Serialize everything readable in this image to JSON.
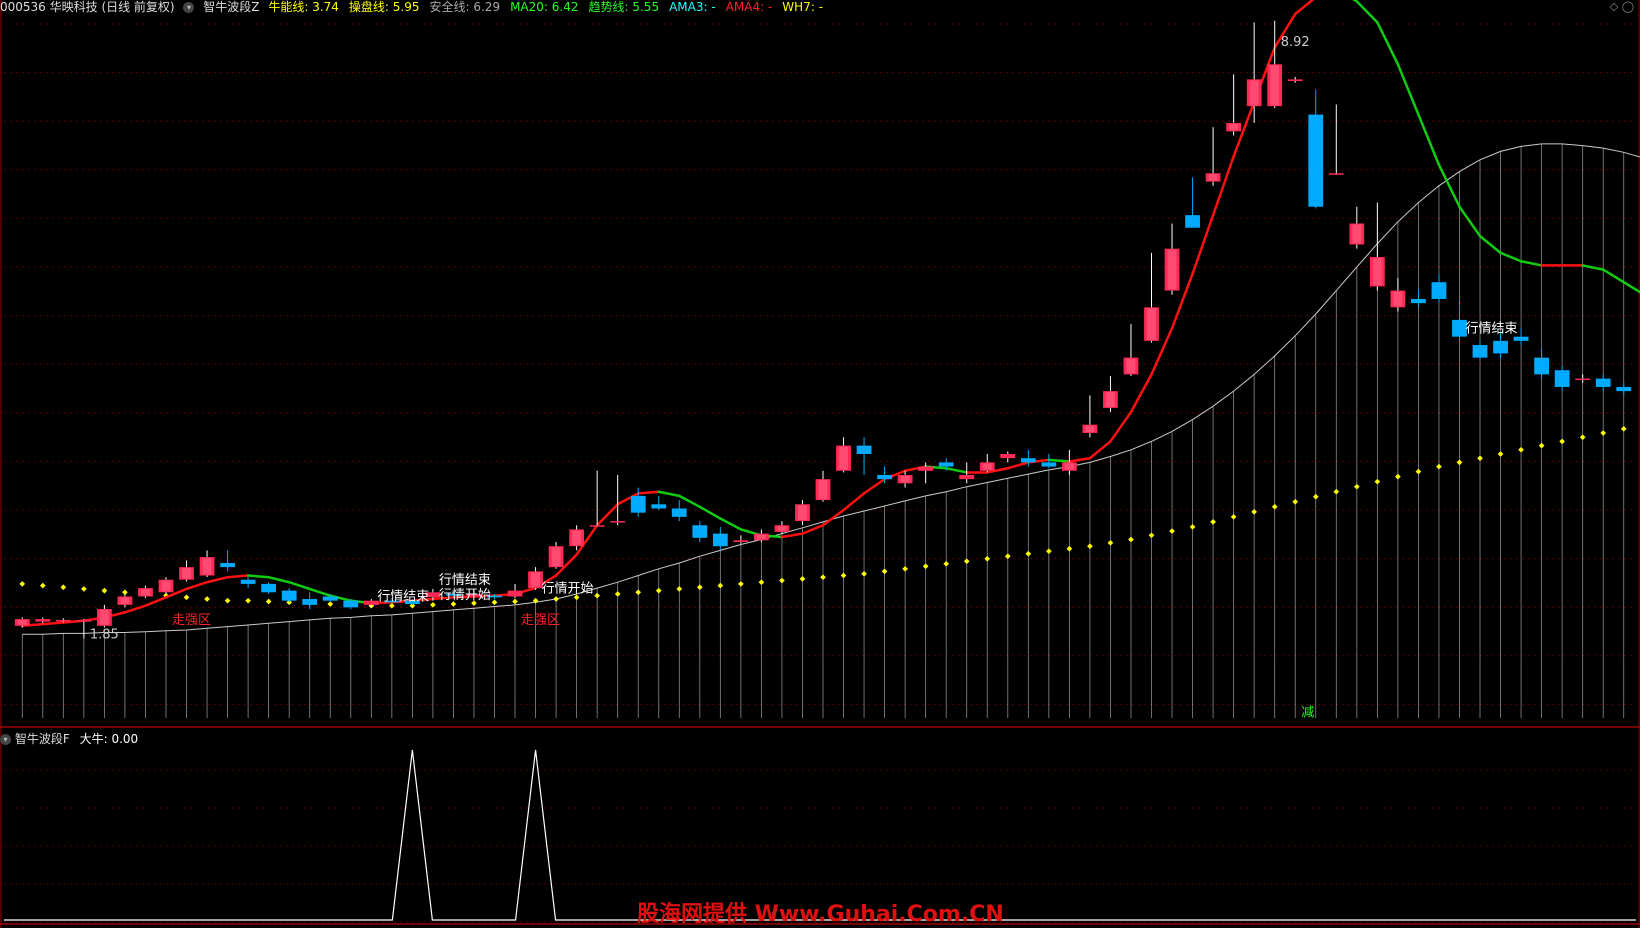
{
  "header": {
    "code_name": "000536 华映科技 (日线 前复权)",
    "indicator": "智牛波段Z",
    "items": [
      {
        "label": "牛能线:",
        "value": "3.74",
        "color": "#ffff00"
      },
      {
        "label": "操盘线:",
        "value": "5.95",
        "color": "#ffff00"
      },
      {
        "label": "安全线:",
        "value": "6.29",
        "color": "#aaaaaa"
      },
      {
        "label": "MA20:",
        "value": "6.42",
        "color": "#22ff22"
      },
      {
        "label": "趋势线:",
        "value": "5.55",
        "color": "#22ff22"
      },
      {
        "label": "AMA3:",
        "value": "-",
        "color": "#22ffff"
      },
      {
        "label": "AMA4:",
        "value": "-",
        "color": "#ff2222"
      },
      {
        "label": "WH7:",
        "value": "-",
        "color": "#ffff00"
      }
    ]
  },
  "sub_header": {
    "indicator": "智牛波段F",
    "label": "大牛:",
    "value": "0.00"
  },
  "watermark": "股海网提供 Www.Guhai.Com.CN",
  "colors": {
    "up": "#ff2a55",
    "down": "#00aaff",
    "trend_up": "#ff1111",
    "trend_down": "#11cc11",
    "dots": "#ffff00",
    "grid": "#5a0000"
  },
  "chart_data": [
    {
      "type": "candlestick",
      "ylim": [
        0.9,
        9.3
      ],
      "annotations": [
        {
          "text": "8.92",
          "index": 61,
          "price": 8.92,
          "color": "#cccccc"
        },
        {
          "text": "1.85",
          "index": 3,
          "price": 1.85,
          "color": "#cccccc"
        },
        {
          "text": "走强区",
          "index": 7,
          "price": 2.02,
          "color": "#ff2222"
        },
        {
          "text": "走强区",
          "index": 24,
          "price": 2.02,
          "color": "#ff2222"
        },
        {
          "text": "行情结束",
          "index": 17,
          "price": 2.3,
          "color": "#ffffff"
        },
        {
          "text": "行情结束",
          "index": 20,
          "price": 2.5,
          "color": "#ffffff"
        },
        {
          "text": "行情开始",
          "index": 20,
          "price": 2.32,
          "color": "#ffffff"
        },
        {
          "text": "行情开始",
          "index": 25,
          "price": 2.4,
          "color": "#ffffff"
        },
        {
          "text": "行情结束",
          "index": 70,
          "price": 5.5,
          "color": "#ffffff"
        },
        {
          "text": "减",
          "index": 62,
          "price": 0.92,
          "color": "#22ff22"
        }
      ],
      "candles": [
        [
          2.0,
          2.08,
          2.1,
          1.98
        ],
        [
          2.05,
          2.08,
          2.1,
          2.03
        ],
        [
          2.06,
          2.07,
          2.09,
          2.04
        ],
        [
          2.05,
          2.07,
          2.08,
          1.85
        ],
        [
          2.0,
          2.2,
          2.25,
          1.98
        ],
        [
          2.25,
          2.35,
          2.38,
          2.22
        ],
        [
          2.35,
          2.45,
          2.48,
          2.33
        ],
        [
          2.4,
          2.55,
          2.58,
          2.38
        ],
        [
          2.55,
          2.7,
          2.78,
          2.53
        ],
        [
          2.6,
          2.82,
          2.9,
          2.58
        ],
        [
          2.75,
          2.7,
          2.9,
          2.65
        ],
        [
          2.55,
          2.5,
          2.58,
          2.45
        ],
        [
          2.5,
          2.4,
          2.52,
          2.38
        ],
        [
          2.42,
          2.3,
          2.45,
          2.28
        ],
        [
          2.32,
          2.25,
          2.4,
          2.2
        ],
        [
          2.35,
          2.3,
          2.38,
          2.28
        ],
        [
          2.3,
          2.22,
          2.32,
          2.2
        ],
        [
          2.25,
          2.3,
          2.32,
          2.22
        ],
        [
          2.3,
          2.28,
          2.33,
          2.27
        ],
        [
          2.3,
          2.26,
          2.32,
          2.25
        ],
        [
          2.34,
          2.4,
          2.44,
          2.3
        ],
        [
          2.38,
          2.36,
          2.4,
          2.34
        ],
        [
          2.35,
          2.38,
          2.42,
          2.33
        ],
        [
          2.36,
          2.34,
          2.38,
          2.32
        ],
        [
          2.35,
          2.42,
          2.5,
          2.33
        ],
        [
          2.45,
          2.65,
          2.7,
          2.43
        ],
        [
          2.7,
          2.95,
          3.0,
          2.68
        ],
        [
          2.95,
          3.15,
          3.2,
          2.9
        ],
        [
          3.2,
          3.2,
          3.85,
          3.18
        ],
        [
          3.25,
          3.25,
          3.8,
          3.2
        ],
        [
          3.55,
          3.35,
          3.65,
          3.3
        ],
        [
          3.45,
          3.4,
          3.55,
          3.38
        ],
        [
          3.4,
          3.3,
          3.5,
          3.25
        ],
        [
          3.2,
          3.05,
          3.25,
          3.0
        ],
        [
          3.1,
          2.95,
          3.18,
          2.9
        ],
        [
          3.0,
          3.02,
          3.08,
          2.98
        ],
        [
          3.02,
          3.1,
          3.15,
          3.0
        ],
        [
          3.12,
          3.2,
          3.25,
          3.1
        ],
        [
          3.25,
          3.45,
          3.5,
          3.2
        ],
        [
          3.5,
          3.75,
          3.85,
          3.48
        ],
        [
          3.85,
          4.15,
          4.25,
          3.83
        ],
        [
          4.15,
          4.05,
          4.25,
          3.8
        ],
        [
          3.8,
          3.75,
          3.9,
          3.7
        ],
        [
          3.7,
          3.8,
          3.85,
          3.65
        ],
        [
          3.85,
          3.9,
          3.95,
          3.7
        ],
        [
          3.95,
          3.9,
          4.0,
          3.85
        ],
        [
          3.75,
          3.8,
          3.95,
          3.7
        ],
        [
          3.85,
          3.95,
          4.05,
          3.83
        ],
        [
          4.0,
          4.05,
          4.08,
          3.95
        ],
        [
          4.0,
          3.95,
          4.1,
          3.9
        ],
        [
          3.95,
          3.9,
          4.05,
          3.88
        ],
        [
          3.85,
          3.95,
          4.1,
          3.8
        ],
        [
          4.3,
          4.4,
          4.75,
          4.25
        ],
        [
          4.6,
          4.8,
          4.98,
          4.55
        ],
        [
          5.0,
          5.2,
          5.6,
          4.98
        ],
        [
          5.4,
          5.8,
          6.45,
          5.38
        ],
        [
          6.0,
          6.5,
          6.8,
          5.95
        ],
        [
          6.9,
          6.75,
          7.35,
          6.85
        ],
        [
          7.3,
          7.4,
          7.95,
          7.25
        ],
        [
          7.9,
          8.0,
          8.58,
          7.85
        ],
        [
          8.2,
          8.52,
          9.2,
          8.0
        ],
        [
          8.2,
          8.7,
          9.22,
          8.18
        ],
        [
          8.5,
          8.52,
          8.55,
          8.48
        ],
        [
          8.1,
          7.0,
          8.4,
          6.98
        ],
        [
          7.4,
          7.4,
          8.22,
          7.38
        ],
        [
          6.55,
          6.8,
          7.0,
          6.5
        ],
        [
          6.05,
          6.4,
          7.05,
          6.0
        ],
        [
          5.8,
          6.0,
          6.15,
          5.75
        ],
        [
          5.9,
          5.85,
          6.0,
          5.8
        ],
        [
          6.1,
          5.9,
          6.2,
          5.85
        ],
        [
          5.65,
          5.45,
          5.9,
          5.4
        ],
        [
          5.35,
          5.2,
          5.4,
          5.18
        ],
        [
          5.4,
          5.25,
          5.5,
          5.2
        ],
        [
          5.45,
          5.4,
          5.55,
          5.35
        ],
        [
          5.2,
          5.0,
          5.3,
          4.95
        ],
        [
          5.05,
          4.85,
          5.1,
          4.8
        ],
        [
          4.95,
          4.95,
          5.0,
          4.9
        ],
        [
          4.95,
          4.85,
          5.0,
          4.8
        ],
        [
          4.85,
          4.8,
          4.9,
          4.75
        ]
      ],
      "trend_line": [
        2.0,
        2.02,
        2.04,
        2.06,
        2.1,
        2.16,
        2.24,
        2.34,
        2.44,
        2.52,
        2.58,
        2.6,
        2.58,
        2.52,
        2.44,
        2.36,
        2.3,
        2.27,
        2.28,
        2.3,
        2.32,
        2.34,
        2.35,
        2.36,
        2.38,
        2.45,
        2.6,
        2.85,
        3.2,
        3.45,
        3.58,
        3.6,
        3.55,
        3.42,
        3.28,
        3.15,
        3.08,
        3.06,
        3.1,
        3.2,
        3.38,
        3.58,
        3.75,
        3.85,
        3.9,
        3.88,
        3.83,
        3.83,
        3.88,
        3.95,
        3.98,
        3.96,
        4.0,
        4.2,
        4.55,
        5.0,
        5.55,
        6.2,
        6.9,
        7.6,
        8.25,
        8.9,
        9.3,
        9.5,
        9.6,
        9.45,
        9.2,
        8.7,
        8.1,
        7.5,
        7.0,
        6.65,
        6.45,
        6.35,
        6.3,
        6.3,
        6.3,
        6.25,
        6.1,
        5.95
      ],
      "safety_line": [
        1.9,
        1.9,
        1.91,
        1.91,
        1.92,
        1.92,
        1.93,
        1.94,
        1.95,
        1.97,
        1.99,
        2.01,
        2.03,
        2.05,
        2.07,
        2.09,
        2.1,
        2.12,
        2.13,
        2.15,
        2.17,
        2.19,
        2.21,
        2.23,
        2.25,
        2.28,
        2.32,
        2.38,
        2.45,
        2.52,
        2.6,
        2.68,
        2.75,
        2.83,
        2.9,
        2.97,
        3.03,
        3.1,
        3.17,
        3.24,
        3.31,
        3.37,
        3.43,
        3.49,
        3.55,
        3.6,
        3.66,
        3.71,
        3.76,
        3.81,
        3.86,
        3.9,
        3.95,
        4.02,
        4.1,
        4.2,
        4.32,
        4.46,
        4.62,
        4.8,
        5.0,
        5.22,
        5.46,
        5.72,
        6.0,
        6.28,
        6.56,
        6.82,
        7.05,
        7.25,
        7.42,
        7.56,
        7.66,
        7.72,
        7.75,
        7.75,
        7.73,
        7.7,
        7.65,
        7.58
      ],
      "yellow_dots": [
        2.5,
        2.48,
        2.46,
        2.44,
        2.42,
        2.4,
        2.38,
        2.36,
        2.34,
        2.32,
        2.3,
        2.3,
        2.29,
        2.28,
        2.27,
        2.26,
        2.25,
        2.24,
        2.24,
        2.24,
        2.25,
        2.26,
        2.27,
        2.28,
        2.29,
        2.3,
        2.32,
        2.34,
        2.36,
        2.38,
        2.4,
        2.42,
        2.44,
        2.46,
        2.48,
        2.5,
        2.52,
        2.54,
        2.56,
        2.58,
        2.6,
        2.62,
        2.65,
        2.68,
        2.71,
        2.74,
        2.77,
        2.8,
        2.83,
        2.86,
        2.89,
        2.92,
        2.95,
        2.99,
        3.03,
        3.08,
        3.13,
        3.18,
        3.24,
        3.3,
        3.36,
        3.42,
        3.48,
        3.54,
        3.6,
        3.66,
        3.72,
        3.78,
        3.84,
        3.9,
        3.95,
        4.0,
        4.05,
        4.1,
        4.15,
        4.2,
        4.25,
        4.3,
        4.35,
        4.4
      ]
    },
    {
      "type": "line",
      "series_label": "大牛",
      "spikes_at": [
        19,
        25
      ],
      "ylim": [
        0,
        1
      ]
    }
  ]
}
